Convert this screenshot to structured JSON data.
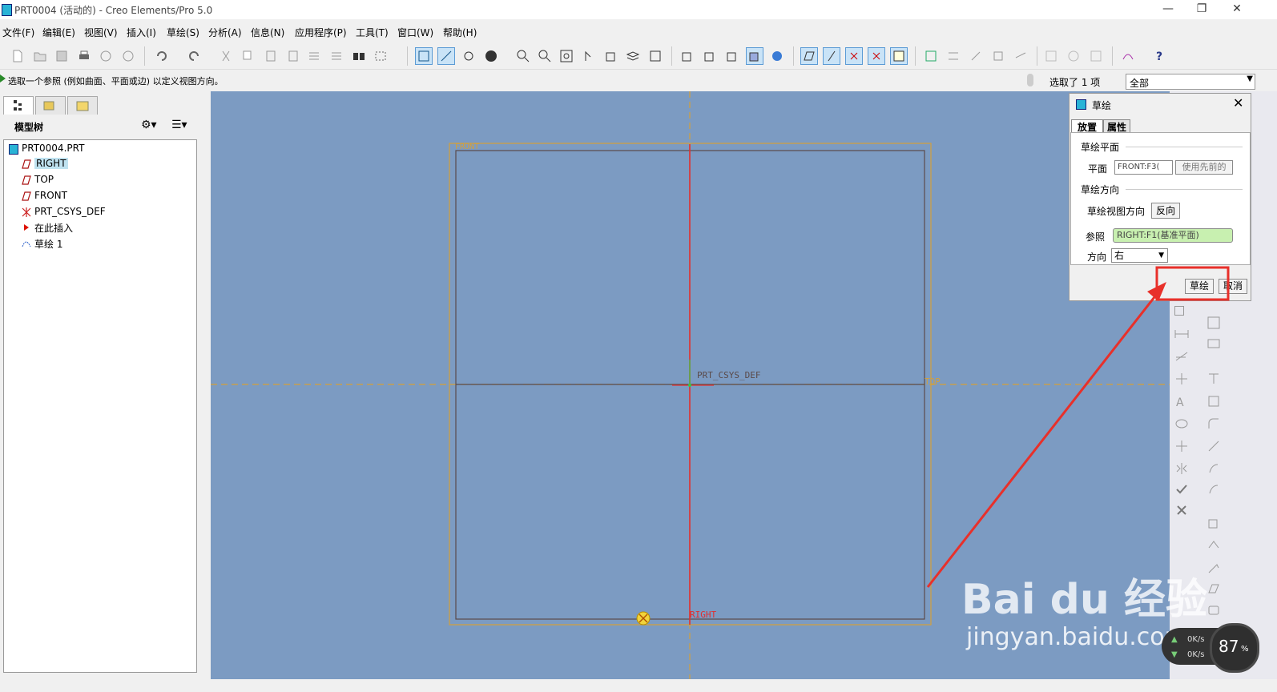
{
  "window": {
    "title": "PRT0004 (活动的) - Creo Elements/Pro 5.0",
    "controls": [
      "—",
      "❐",
      "✕"
    ]
  },
  "menubar": [
    "文件(F)",
    "编辑(E)",
    "视图(V)",
    "插入(I)",
    "草绘(S)",
    "分析(A)",
    "信息(N)",
    "应用程序(P)",
    "工具(T)",
    "窗口(W)",
    "帮助(H)"
  ],
  "message": {
    "text": "选取一个参照 (例如曲面、平面或边) 以定义视图方向。",
    "selection_count": "选取了 1 项",
    "filter_value": "全部"
  },
  "model_tree": {
    "header": "模型树",
    "root": "PRT0004.PRT",
    "items": [
      {
        "label": "RIGHT",
        "icon": "datum-plane-icon",
        "selected": true
      },
      {
        "label": "TOP",
        "icon": "datum-plane-icon"
      },
      {
        "label": "FRONT",
        "icon": "datum-plane-icon"
      },
      {
        "label": "PRT_CSYS_DEF",
        "icon": "csys-icon"
      },
      {
        "label": "在此插入",
        "icon": "insert-here-arrow-icon"
      },
      {
        "label": "草绘 1",
        "icon": "sketch-icon"
      }
    ]
  },
  "graphics": {
    "labels": {
      "front": "FRONT",
      "top": "TOP",
      "right": "RIGHT",
      "csys": "PRT_CSYS_DEF"
    },
    "colors": {
      "background": "#7c9bc2",
      "datum_plane": "#d4a03a",
      "sketch_plane_border": "#5a4a4a",
      "highlight": "#e03030"
    }
  },
  "sketch_dialog": {
    "title": "草绘",
    "tabs": [
      "放置",
      "属性"
    ],
    "section_plane": "草绘平面",
    "plane_label": "平面",
    "plane_value": "FRONT:F3(",
    "use_previous": "使用先前的",
    "section_orientation": "草绘方向",
    "view_direction_label": "草绘视图方向",
    "flip_button": "反向",
    "reference_label": "参照",
    "reference_value": "RIGHT:F1(基准平面)",
    "orientation_label": "方向",
    "orientation_value": "右",
    "sketch_button": "草绘",
    "cancel_button": "取消"
  },
  "watermark": {
    "brand": "Bai du 经验",
    "url": "jingyan.baidu.com"
  },
  "net_widget": {
    "upload": "0K/s",
    "download": "0K/s",
    "percent": "87",
    "percent_unit": "%"
  }
}
